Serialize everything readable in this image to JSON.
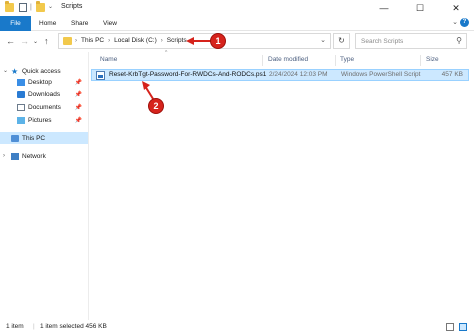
{
  "window": {
    "title": "Scripts",
    "minimize_glyph": "—",
    "maximize_glyph": "☐",
    "close_glyph": "✕",
    "quick_access_separator": "|"
  },
  "ribbon": {
    "tabs": [
      "File",
      "Home",
      "Share",
      "View"
    ],
    "expand_glyph": "⌄",
    "help_glyph": "?"
  },
  "navigation": {
    "back_glyph": "←",
    "forward_glyph": "→",
    "recent_glyph": "⌄",
    "up_glyph": "↑"
  },
  "address": {
    "breadcrumbs": [
      "This PC",
      "Local Disk (C:)",
      "Scripts"
    ],
    "separator": "›",
    "dropdown_glyph": "⌄",
    "refresh_glyph": "↻"
  },
  "search": {
    "placeholder": "Search Scripts",
    "icon": "search-icon",
    "glyph": "⚲"
  },
  "sidebar": {
    "quick_access_label": "Quick access",
    "items": [
      {
        "label": "Desktop",
        "icon": "desktop-icon",
        "pinned": true
      },
      {
        "label": "Downloads",
        "icon": "downloads-icon",
        "pinned": true
      },
      {
        "label": "Documents",
        "icon": "documents-icon",
        "pinned": true
      },
      {
        "label": "Pictures",
        "icon": "pictures-icon",
        "pinned": true
      }
    ],
    "this_pc_label": "This PC",
    "network_label": "Network",
    "pin_glyph": "📌",
    "expand_glyph": "›",
    "collapse_glyph": "⌄",
    "quick_access_glyph": "★"
  },
  "columns": {
    "name": "Name",
    "date_modified": "Date modified",
    "type": "Type",
    "size": "Size",
    "sort_glyph": "^"
  },
  "files": [
    {
      "name": "Reset-KrbTgt-Password-For-RWDCs-And-RODCs.ps1",
      "date_modified": "2/24/2024 12:03 PM",
      "type": "Windows PowerShell Script",
      "size": "457 KB",
      "selected": true
    }
  ],
  "annotations": {
    "callout_1": "1",
    "callout_2": "2",
    "color": "#d6231c"
  },
  "status": {
    "item_count": "1 item",
    "selection": "1 item selected  456 KB"
  },
  "colors": {
    "accent": "#1979ca",
    "selection_bg": "#cce8ff",
    "folder": "#f2c94c"
  }
}
